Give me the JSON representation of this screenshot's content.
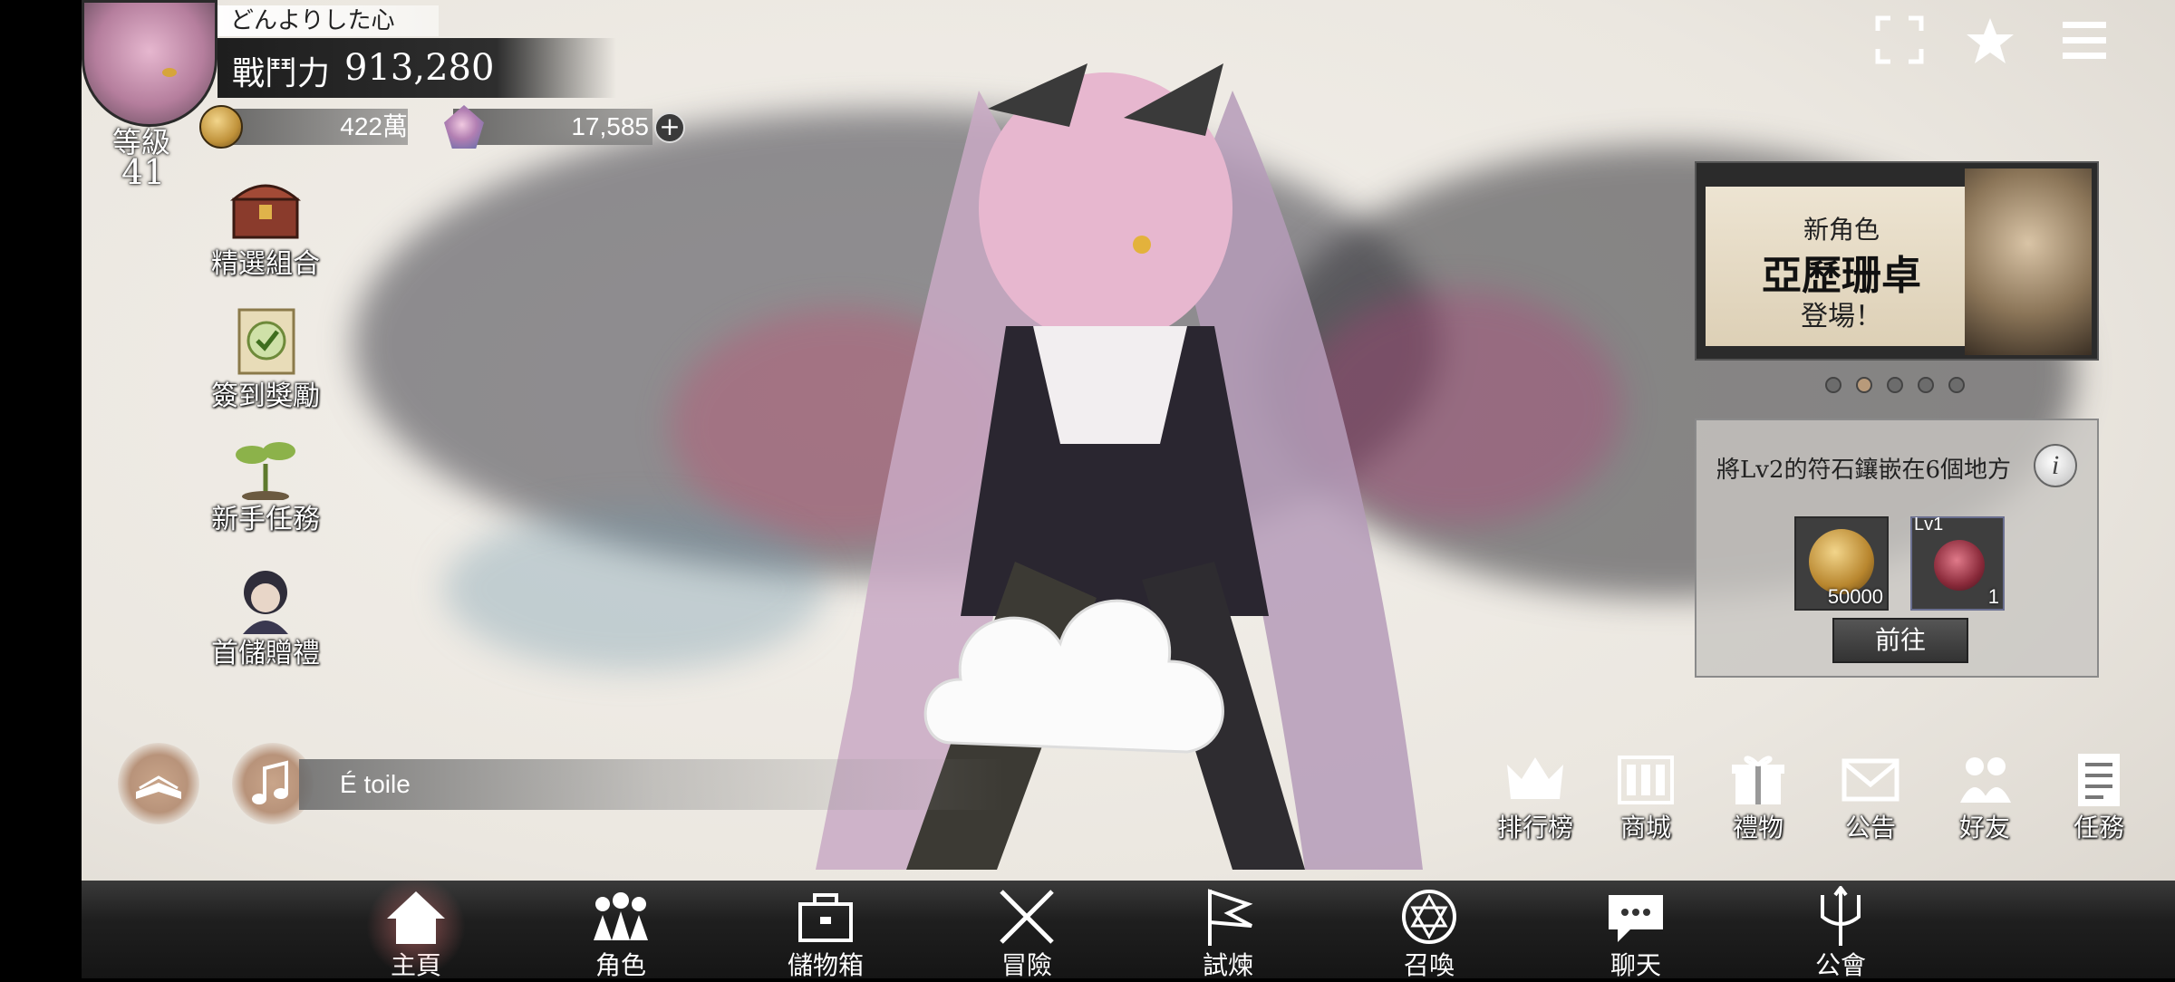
{
  "player": {
    "name": "どんよりした心",
    "combat_label": "戰鬥力",
    "combat_power": "913,280",
    "level_label": "等級",
    "level": "41",
    "gold": "422萬",
    "gems": "17,585"
  },
  "side_menu": [
    {
      "label": "精選組合",
      "icon": "treasure-chest-icon"
    },
    {
      "label": "簽到獎勵",
      "icon": "checkin-scroll-icon"
    },
    {
      "label": "新手任務",
      "icon": "sprout-icon"
    },
    {
      "label": "首儲贈禮",
      "icon": "character-portrait-icon"
    }
  ],
  "top_right": [
    "fullscreen-icon",
    "star-icon",
    "menu-icon"
  ],
  "banner": {
    "subtitle": "新角色",
    "title": "亞歷珊卓",
    "tail": "登場！",
    "page_dots": 5,
    "active_dot": 2
  },
  "mission": {
    "text": "將Lv2的符石鑲嵌在6個地方",
    "rewards": [
      {
        "type": "gold-coin",
        "count": "50000",
        "level": ""
      },
      {
        "type": "rune-stone",
        "count": "1",
        "level": "Lv1"
      }
    ],
    "go_label": "前往"
  },
  "music": {
    "track": "É toile"
  },
  "utility": [
    {
      "label": "排行榜",
      "icon": "crown-icon"
    },
    {
      "label": "商城",
      "icon": "shop-icon"
    },
    {
      "label": "禮物",
      "icon": "gift-icon"
    },
    {
      "label": "公告",
      "icon": "mail-icon"
    },
    {
      "label": "好友",
      "icon": "friends-icon"
    },
    {
      "label": "任務",
      "icon": "task-list-icon"
    }
  ],
  "bottom_nav": [
    {
      "label": "主頁",
      "icon": "home-icon",
      "active": true
    },
    {
      "label": "角色",
      "icon": "characters-icon"
    },
    {
      "label": "儲物箱",
      "icon": "storage-box-icon"
    },
    {
      "label": "冒險",
      "icon": "crossed-swords-icon"
    },
    {
      "label": "試煉",
      "icon": "flag-icon"
    },
    {
      "label": "召喚",
      "icon": "summon-circle-icon"
    },
    {
      "label": "聊天",
      "icon": "chat-icon"
    },
    {
      "label": "公會",
      "icon": "guild-trident-icon"
    }
  ]
}
